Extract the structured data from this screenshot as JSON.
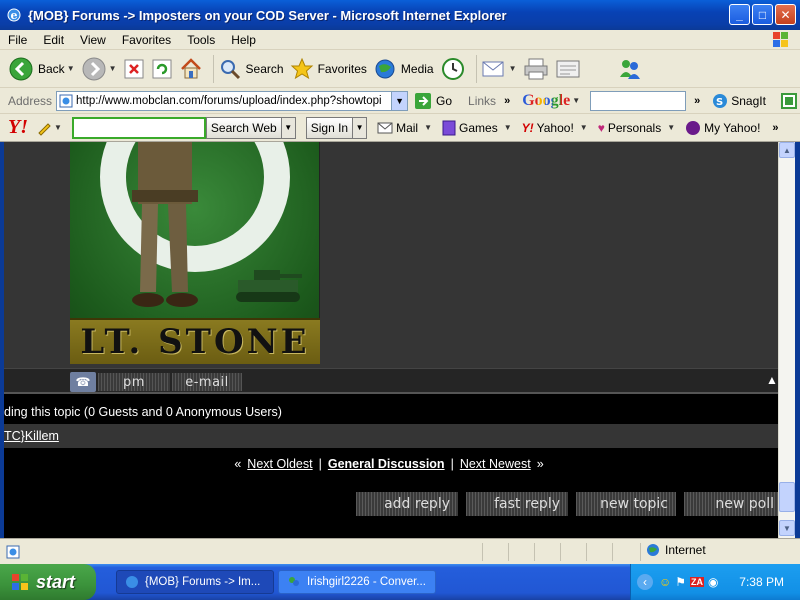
{
  "window": {
    "title": "{MOB} Forums -> Imposters on your COD Server - Microsoft Internet Explorer",
    "buttons": [
      "_",
      "□",
      "✕"
    ]
  },
  "menu": [
    "File",
    "Edit",
    "View",
    "Favorites",
    "Tools",
    "Help"
  ],
  "toolbar": {
    "back": "Back",
    "search": "Search",
    "favorites": "Favorites",
    "media": "Media"
  },
  "address": {
    "label": "Address",
    "url": "http://www.mobclan.com/forums/upload/index.php?showtopi",
    "go": "Go",
    "links": "Links",
    "google": "Google",
    "snagit": "SnagIt"
  },
  "yahoo": {
    "search_web": "Search Web",
    "sign_in": "Sign In",
    "mail": "Mail",
    "games": "Games",
    "yahoo": "Yahoo!",
    "personals": "Personals",
    "my_yahoo": "My Yahoo!"
  },
  "forum": {
    "avatar_name": "LT. STONE",
    "pm_label": "pm",
    "email_label": "e-mail",
    "stats_text": "ding this topic (0 Guests and 0 Anonymous Users)",
    "member_link": "TC}Killem",
    "nav": {
      "open": "«",
      "next_oldest": "Next Oldest",
      "sep1": "|",
      "general": "General Discussion",
      "sep2": "|",
      "next_newest": "Next Newest",
      "close": "»"
    },
    "buttons": {
      "add_reply": "add reply",
      "fast_reply": "fast reply",
      "new_topic": "new topic",
      "new_poll": "new poll"
    }
  },
  "status": {
    "zone": "Internet"
  },
  "taskbar": {
    "start": "start",
    "tasks": [
      "{MOB} Forums -> Im...",
      "Irishgirl2226 - Conver..."
    ],
    "clock": "7:38 PM"
  },
  "colors": {
    "title_blue": "#0842b5",
    "xp_chrome": "#ece9d8",
    "page_bg": "#000000",
    "row_bg": "#353535"
  }
}
